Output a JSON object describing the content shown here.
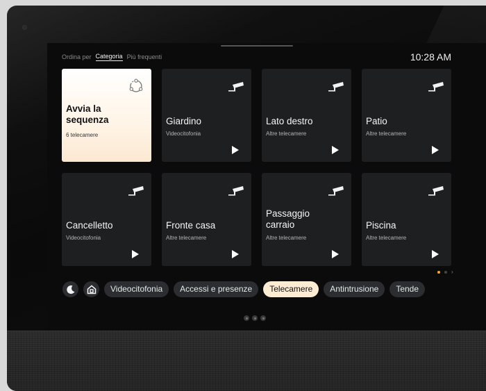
{
  "sort": {
    "label": "Ordina per",
    "options": [
      "Categoria",
      "Più frequenti"
    ],
    "selected": "Categoria"
  },
  "clock": "10:28 AM",
  "cards": [
    {
      "title": "Avvia la sequenza",
      "subtitle": "6 telecamere",
      "icon": "sequence-icon",
      "highlight": true
    },
    {
      "title": "Giardino",
      "subtitle": "Videocitofonia",
      "icon": "camera-icon"
    },
    {
      "title": "Lato destro",
      "subtitle": "Altre telecamere",
      "icon": "camera-icon"
    },
    {
      "title": "Patio",
      "subtitle": "Altre telecamere",
      "icon": "camera-icon"
    },
    {
      "title": "Cancelletto",
      "subtitle": "Videocitofonia",
      "icon": "camera-icon"
    },
    {
      "title": "Fronte casa",
      "subtitle": "Altre telecamere",
      "icon": "camera-icon"
    },
    {
      "title": "Passaggio carraio",
      "subtitle": "Altre telecamere",
      "icon": "camera-icon"
    },
    {
      "title": "Piscina",
      "subtitle": "Altre telecamere",
      "icon": "camera-icon"
    }
  ],
  "pager": {
    "pages": 2,
    "current": 1
  },
  "quick_icons": [
    "moon-icon",
    "home-icon"
  ],
  "categories": [
    "Videocitofonia",
    "Accessi e presenze",
    "Telecamere",
    "Antintrusione",
    "Tende"
  ],
  "selected_category": "Telecamere",
  "colors": {
    "accent": "#fdebd3",
    "pager_active": "#f5a623",
    "card_bg": "#1d1f21",
    "chip_bg": "#2b2d30"
  }
}
